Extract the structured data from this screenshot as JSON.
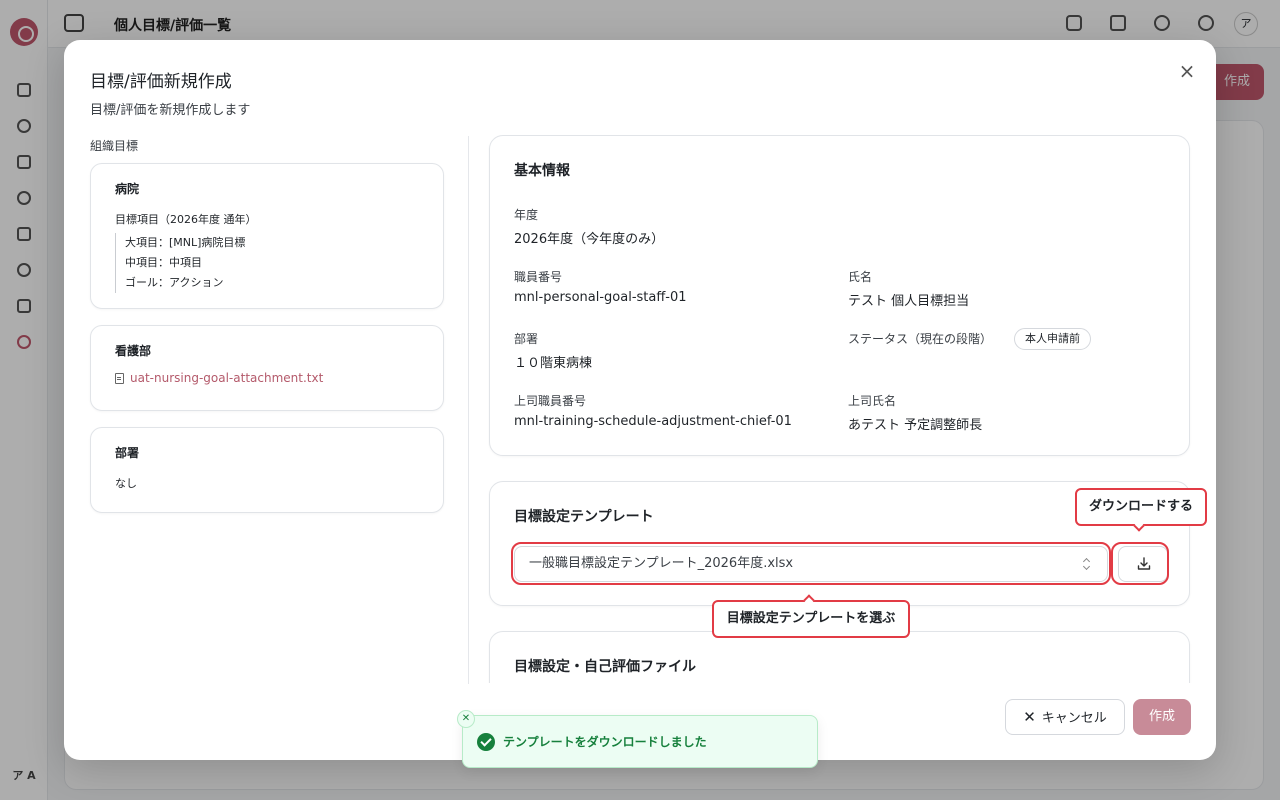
{
  "app": {
    "header_title": "個人目標/評価一覧",
    "avatar_initial": "ア",
    "sidebar_avatar": "ア A",
    "background_create_label": "作成"
  },
  "modal": {
    "title": "目標/評価新規作成",
    "description": "目標/評価を新規作成します",
    "close_icon": "×"
  },
  "org_goals": {
    "label": "組織目標",
    "hospital": {
      "title": "病院",
      "goal_header": "目標項目（2026年度 通年）",
      "lines": [
        "大項目：[MNL]病院目標",
        "中項目：中項目",
        "ゴール：アクション"
      ]
    },
    "nursing": {
      "title": "看護部",
      "attachment": "uat-nursing-goal-attachment.txt"
    },
    "department": {
      "title": "部署",
      "value": "なし"
    }
  },
  "basic_info": {
    "title": "基本情報",
    "year_label": "年度",
    "year_value": "2026年度（今年度のみ）",
    "staff_no_label": "職員番号",
    "staff_no_value": "mnl-personal-goal-staff-01",
    "name_label": "氏名",
    "name_value": "テスト 個人目標担当",
    "dept_label": "部署",
    "dept_value": "１０階東病棟",
    "status_label": "ステータス（現在の段階）",
    "status_value": "本人申請前",
    "boss_no_label": "上司職員番号",
    "boss_no_value": "mnl-training-schedule-adjustment-chief-01",
    "boss_name_label": "上司氏名",
    "boss_name_value": "あテスト 予定調整師長"
  },
  "template": {
    "title": "目標設定テンプレート",
    "selected": "一般職目標設定テンプレート_2026年度.xlsx",
    "download_tooltip": "ダウンロードする",
    "select_tooltip": "目標設定テンプレートを選ぶ"
  },
  "self_eval": {
    "title": "目標設定・自己評価ファイル"
  },
  "footer": {
    "cancel_label": "キャンセル",
    "create_label": "作成"
  },
  "toast": {
    "message": "テンプレートをダウンロードしました"
  },
  "colors": {
    "accent": "#c0576c",
    "highlight": "#e23b45",
    "success": "#16803c"
  }
}
